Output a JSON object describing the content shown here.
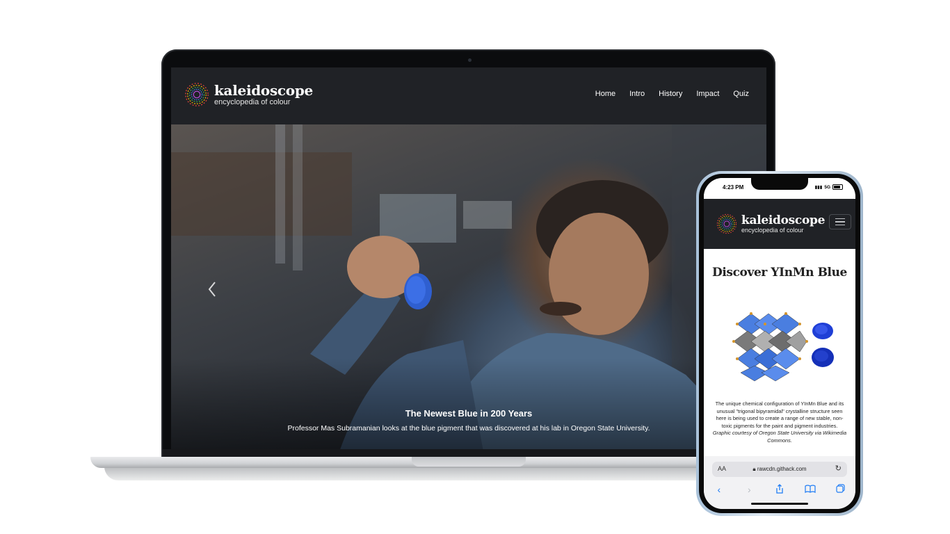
{
  "site": {
    "name": "kaleidoscope",
    "tagline": "encyclopedia of colour"
  },
  "nav": {
    "items": [
      "Home",
      "Intro",
      "History",
      "Impact",
      "Quiz"
    ]
  },
  "carousel": {
    "prev_icon": "chevron-left-icon",
    "caption_title": "The Newest Blue in 200 Years",
    "caption_text": "Professor Mas Subramanian looks at the blue pigment that was discovered at his lab in Oregon State University."
  },
  "phone": {
    "status": {
      "time": "4:23 PM",
      "network": "5G"
    },
    "page": {
      "title": "Discover YInMn Blue",
      "caption": "The unique chemical configuration of YInMn Blue and its unusual \"trigonal bipyramidal\" crystalline structure seen here is being used to create a range of new stable, non-toxic pigments for the paint and pigment industries.",
      "credit": "Graphic courtesy of Oregon State University via Wikimedia Commons."
    },
    "browser": {
      "text_size_label": "AA",
      "url": "rawcdn.githack.com"
    }
  },
  "colors": {
    "header_bg": "#202226",
    "accent_blue": "#2f5fd0",
    "safari_blue": "#1e7cf5"
  }
}
